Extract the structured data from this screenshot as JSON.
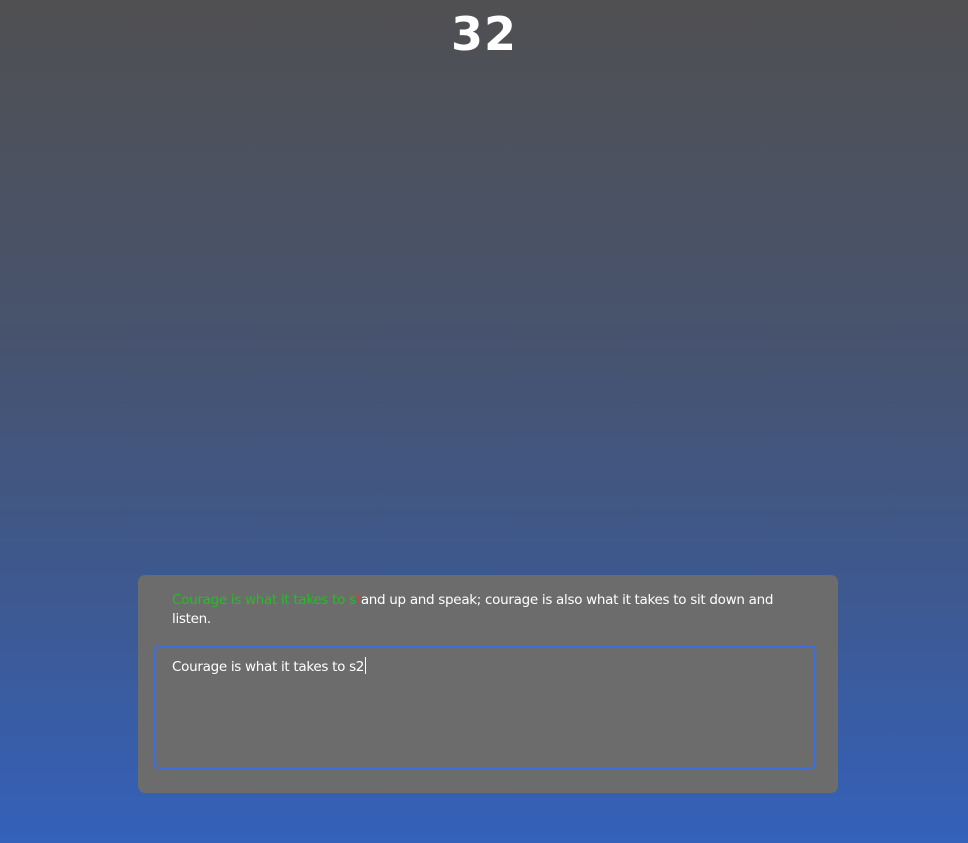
{
  "timer": {
    "value": "32"
  },
  "prompt": {
    "typed_correct": "Courage is what it takes to s",
    "typed_error": "t",
    "remaining": "and up and speak; courage is also what it takes to sit down and listen."
  },
  "input": {
    "value": "Courage is what it takes to s2"
  },
  "colors": {
    "correct": "#1fc21f",
    "error": "#e03a2a",
    "focus_border": "#3b6ee0"
  }
}
